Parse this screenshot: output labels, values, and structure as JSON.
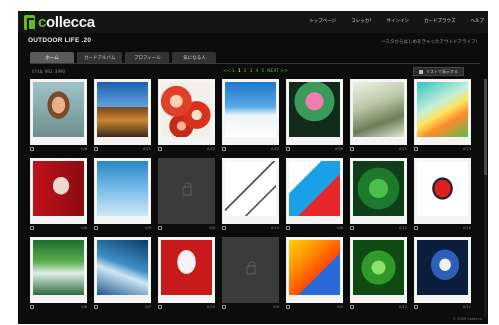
{
  "app": {
    "logo_prefix": "c",
    "logo_rest": "ollecca",
    "brand_color": "#5fbe1e"
  },
  "header": {
    "nav": [
      "トップページ",
      "コレッカ?",
      "サインイン",
      "カードブラウズ",
      "ヘルプ"
    ],
    "page_title": "OUTDOOR LIFE .20",
    "tagline": "～スタからはしめをきゃったアウトドアライフ！"
  },
  "tabs": [
    {
      "label": "ホーム",
      "active": true
    },
    {
      "label": "カードアルバム",
      "active": false
    },
    {
      "label": "プロフィール",
      "active": false
    },
    {
      "label": "気になる人",
      "active": false
    }
  ],
  "toolbar": {
    "count_text": "0748, 992, 3990",
    "prev": "<< 1",
    "pages": [
      "1",
      "2",
      "3",
      "4",
      "5"
    ],
    "next": "NEXT >>",
    "list_button": "リストで表示する"
  },
  "cards": [
    {
      "fill": "f1",
      "locked": false,
      "count": "0/8"
    },
    {
      "fill": "f2",
      "locked": false,
      "count": "0/11"
    },
    {
      "fill": "f3",
      "locked": false,
      "count": "0/12"
    },
    {
      "fill": "f4",
      "locked": false,
      "count": "0/12"
    },
    {
      "fill": "f5",
      "locked": false,
      "count": "0/38"
    },
    {
      "fill": "f6",
      "locked": false,
      "count": "0/11"
    },
    {
      "fill": "f7",
      "locked": false,
      "count": "0/13"
    },
    {
      "fill": "f8",
      "locked": false,
      "count": "0/8"
    },
    {
      "fill": "f9",
      "locked": false,
      "count": "0/9"
    },
    {
      "fill": "",
      "locked": true,
      "count": "0/4"
    },
    {
      "fill": "f11",
      "locked": false,
      "count": "0/14"
    },
    {
      "fill": "f12",
      "locked": false,
      "count": "0/8"
    },
    {
      "fill": "f13",
      "locked": false,
      "count": "0/12"
    },
    {
      "fill": "f14",
      "locked": false,
      "count": "0/16"
    },
    {
      "fill": "f15",
      "locked": false,
      "count": "0/8"
    },
    {
      "fill": "f16",
      "locked": false,
      "count": "0/7"
    },
    {
      "fill": "f17",
      "locked": false,
      "count": "0/20"
    },
    {
      "fill": "",
      "locked": true,
      "count": "0/4"
    },
    {
      "fill": "f19",
      "locked": false,
      "count": "0/5"
    },
    {
      "fill": "f20",
      "locked": false,
      "count": "0/12"
    },
    {
      "fill": "f21",
      "locked": false,
      "count": "0/11"
    }
  ],
  "footer": "© 2009 collecca"
}
